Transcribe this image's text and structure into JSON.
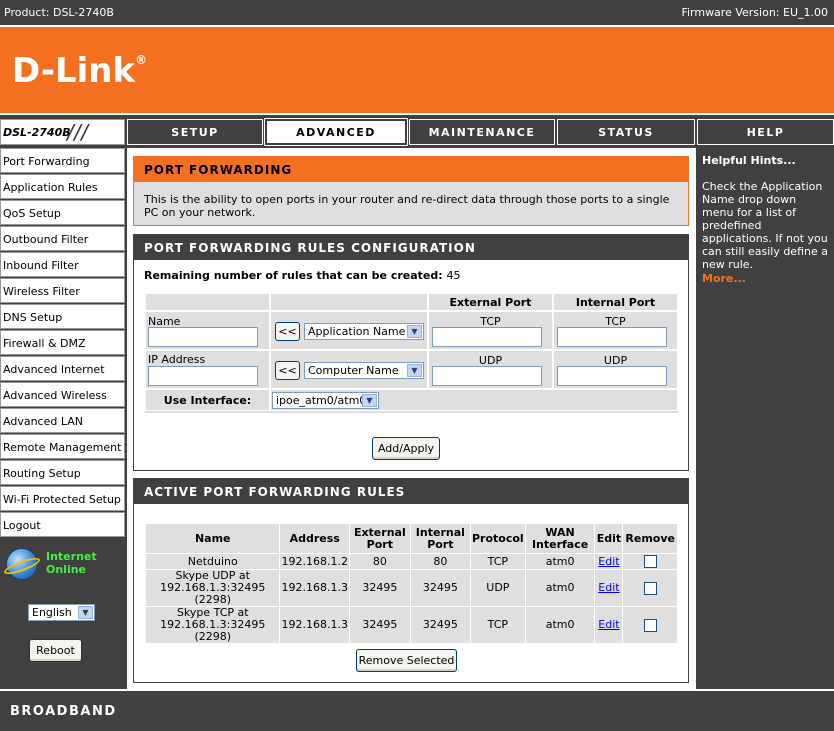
{
  "topbar": {
    "product": "Product: DSL-2740B",
    "firmware": "Firmware Version: EU_1.00"
  },
  "logo": {
    "text": "D-Link",
    "mark": "®"
  },
  "model": "DSL-2740B",
  "tabs": [
    {
      "label": "SETUP"
    },
    {
      "label": "ADVANCED",
      "active": true
    },
    {
      "label": "MAINTENANCE"
    },
    {
      "label": "STATUS"
    },
    {
      "label": "HELP"
    }
  ],
  "sidebar": {
    "items": [
      "Port Forwarding",
      "Application Rules",
      "QoS Setup",
      "Outbound Filter",
      "Inbound Filter",
      "Wireless Filter",
      "DNS Setup",
      "Firewall & DMZ",
      "Advanced Internet",
      "Advanced Wireless",
      "Advanced LAN",
      "Remote Management",
      "Routing Setup",
      "Wi-Fi Protected Setup",
      "Logout"
    ],
    "internet_status_line1": "Internet",
    "internet_status_line2": "Online",
    "language": "English",
    "reboot": "Reboot"
  },
  "port_forwarding": {
    "title": "PORT FORWARDING",
    "description": "This is the ability to open ports in your router and re-direct data through those ports to a single PC on your network."
  },
  "config": {
    "title": "PORT FORWARDING RULES CONFIGURATION",
    "remaining_label": "Remaining number of rules that can be created:",
    "remaining_value": "45",
    "external_port": "External Port",
    "internal_port": "Internal Port",
    "name_label": "Name",
    "ip_label": "IP Address",
    "copy_btn": "<<",
    "app_name_select": "Application Name",
    "computer_name_select": "Computer Name",
    "tcp": "TCP",
    "udp": "UDP",
    "use_interface_label": "Use Interface:",
    "interface_value": "ipoe_atm0/atm0",
    "add_apply": "Add/Apply"
  },
  "active_rules": {
    "title": "ACTIVE PORT FORWARDING RULES",
    "headers": [
      "Name",
      "Address",
      "External Port",
      "Internal Port",
      "Protocol",
      "WAN Interface",
      "Edit",
      "Remove"
    ],
    "rows": [
      {
        "name": "Netduino",
        "address": "192.168.1.2",
        "ext": "80",
        "int": "80",
        "protocol": "TCP",
        "wan": "atm0",
        "edit": "Edit"
      },
      {
        "name": "Skype UDP at 192.168.1.3:32495 (2298)",
        "address": "192.168.1.3",
        "ext": "32495",
        "int": "32495",
        "protocol": "UDP",
        "wan": "atm0",
        "edit": "Edit"
      },
      {
        "name": "Skype TCP at 192.168.1.3:32495 (2298)",
        "address": "192.168.1.3",
        "ext": "32495",
        "int": "32495",
        "protocol": "TCP",
        "wan": "atm0",
        "edit": "Edit"
      }
    ],
    "remove_selected": "Remove Selected"
  },
  "help": {
    "title": "Helpful Hints...",
    "body": "Check the Application Name drop down menu for a list of predefined applications. If not you can still easily define a new rule.",
    "more": "More..."
  },
  "footer": {
    "brand": "BROADBAND"
  }
}
